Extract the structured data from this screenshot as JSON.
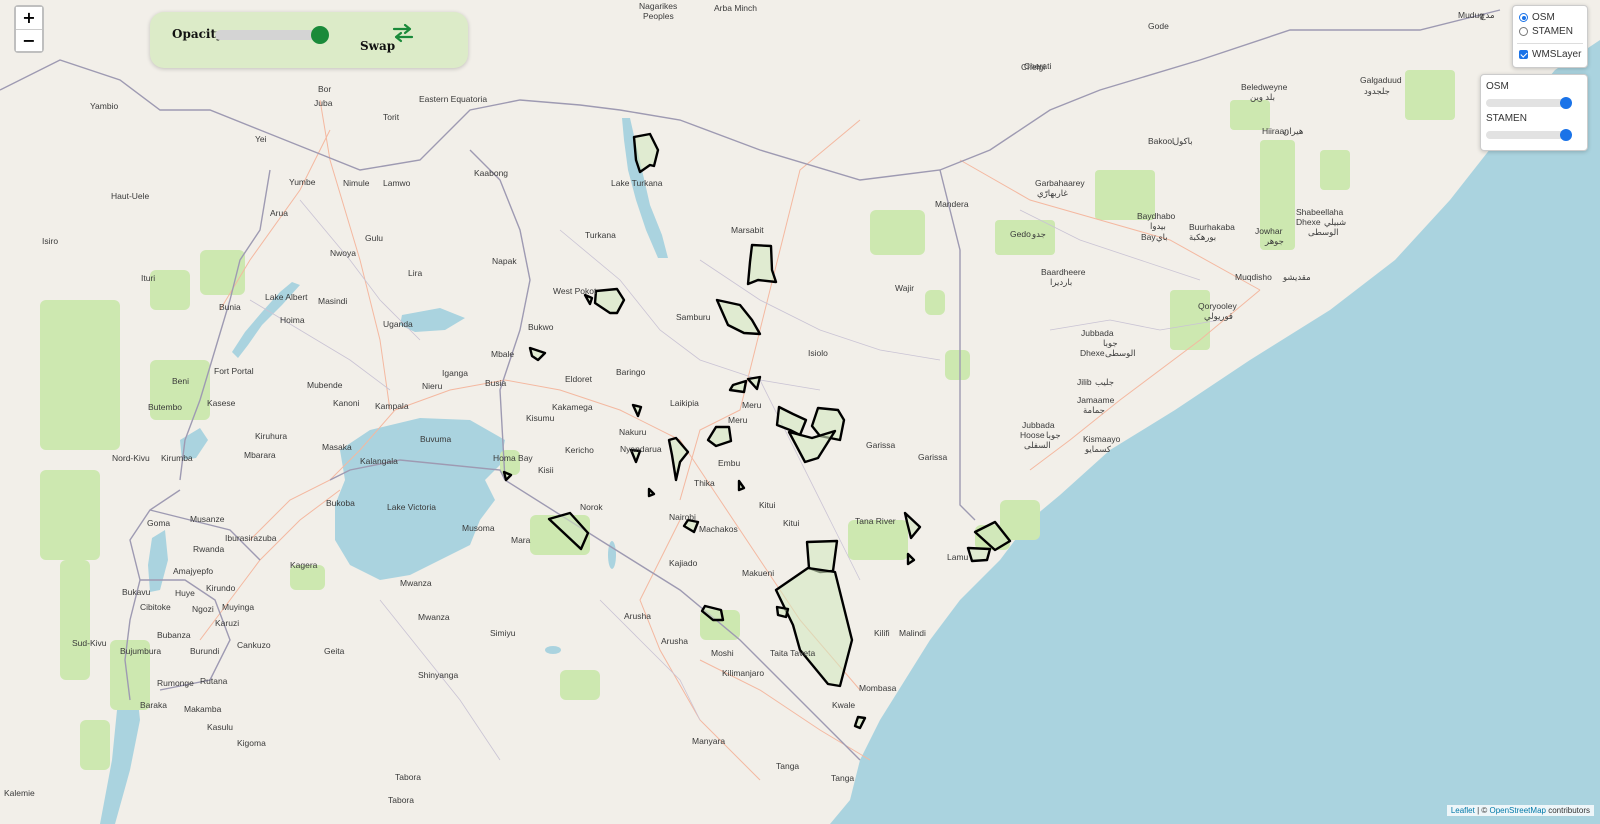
{
  "map": {
    "places": [
      {
        "text": "Nagarikes",
        "cls": "region"
      },
      {
        "text": "Peoples",
        "cls": "region"
      },
      {
        "text": "Arba Minch",
        "cls": "city"
      },
      {
        "text": "Mudug",
        "cls": "region"
      },
      {
        "text": "مدج",
        "cls": "region"
      },
      {
        "text": "Gode",
        "cls": "city"
      },
      {
        "text": "Chelgi",
        "cls": "city"
      },
      {
        "text": "Bor",
        "cls": "city"
      },
      {
        "text": "Juba",
        "cls": "city big"
      },
      {
        "text": "Eastern Equatoria",
        "cls": "region"
      },
      {
        "text": "Yambio",
        "cls": "city"
      },
      {
        "text": "Torit",
        "cls": "city"
      },
      {
        "text": "Yei",
        "cls": "city"
      },
      {
        "text": "Cherati",
        "cls": "city"
      },
      {
        "text": "Beledweyne",
        "cls": "city"
      },
      {
        "text": "بلد وين",
        "cls": "city"
      },
      {
        "text": "Galgaduud",
        "cls": "region"
      },
      {
        "text": "جلجدود",
        "cls": "region"
      },
      {
        "text": "Hiiraan",
        "cls": "region"
      },
      {
        "text": "هيران",
        "cls": "region"
      },
      {
        "text": "Bakool",
        "cls": "region"
      },
      {
        "text": "باكول",
        "cls": "region"
      },
      {
        "text": "Haut-Uele",
        "cls": "region"
      },
      {
        "text": "Yumbe",
        "cls": "city"
      },
      {
        "text": "Nimule",
        "cls": "city"
      },
      {
        "text": "Lamwo",
        "cls": "region"
      },
      {
        "text": "Kaabong",
        "cls": "region"
      },
      {
        "text": "Lake Turkana",
        "cls": "water"
      },
      {
        "text": "Garbahaarey",
        "cls": "city"
      },
      {
        "text": "غاربهارّي",
        "cls": "city"
      },
      {
        "text": "Arua",
        "cls": "city"
      },
      {
        "text": "Gulu",
        "cls": "city"
      },
      {
        "text": "Mandera",
        "cls": "region"
      },
      {
        "text": "Baydhabo",
        "cls": "city"
      },
      {
        "text": "بيدوا",
        "cls": "city"
      },
      {
        "text": "Bay",
        "cls": "region"
      },
      {
        "text": "باي",
        "cls": "region"
      },
      {
        "text": "Buurhakaba",
        "cls": "city"
      },
      {
        "text": "بورهكبة",
        "cls": "city"
      },
      {
        "text": "Jowhar",
        "cls": "city"
      },
      {
        "text": "جوهر",
        "cls": "city"
      },
      {
        "text": "Shabeellaha",
        "cls": "region"
      },
      {
        "text": "Dhexe",
        "cls": "region"
      },
      {
        "text": "شبيلي",
        "cls": "region"
      },
      {
        "text": "الوسطى",
        "cls": "region"
      },
      {
        "text": "Isiro",
        "cls": "city"
      },
      {
        "text": "Turkana",
        "cls": "region"
      },
      {
        "text": "Marsabit",
        "cls": "region"
      },
      {
        "text": "Nwoya",
        "cls": "region"
      },
      {
        "text": "Napak",
        "cls": "region"
      },
      {
        "text": "Gedo",
        "cls": "region"
      },
      {
        "text": "جدو",
        "cls": "region"
      },
      {
        "text": "Baardheere",
        "cls": "city"
      },
      {
        "text": "بارديرا",
        "cls": "city"
      },
      {
        "text": "Muqdisho",
        "cls": "city big"
      },
      {
        "text": "مقديشو",
        "cls": "city big"
      },
      {
        "text": "Ituri",
        "cls": "region"
      },
      {
        "text": "Lira",
        "cls": "city"
      },
      {
        "text": "West Pokot",
        "cls": "region"
      },
      {
        "text": "Wajir",
        "cls": "region"
      },
      {
        "text": "Bunia",
        "cls": "city big"
      },
      {
        "text": "Masindi",
        "cls": "city"
      },
      {
        "text": "Lake Albert",
        "cls": "water"
      },
      {
        "text": "Hoima",
        "cls": "region"
      },
      {
        "text": "Samburu",
        "cls": "region"
      },
      {
        "text": "Qoryooley",
        "cls": "city"
      },
      {
        "text": "قوريولي",
        "cls": "city"
      },
      {
        "text": "Uganda",
        "cls": "country"
      },
      {
        "text": "Bukwo",
        "cls": "city"
      },
      {
        "text": "Jubbada",
        "cls": "region"
      },
      {
        "text": "Dhexe",
        "cls": "region"
      },
      {
        "text": "جوبا",
        "cls": "region"
      },
      {
        "text": "الوسطى",
        "cls": "region"
      },
      {
        "text": "Mbale",
        "cls": "city"
      },
      {
        "text": "Isiolo",
        "cls": "region"
      },
      {
        "text": "Beni",
        "cls": "city"
      },
      {
        "text": "Fort Portal",
        "cls": "city"
      },
      {
        "text": "Iganga",
        "cls": "city"
      },
      {
        "text": "Eldoret",
        "cls": "city"
      },
      {
        "text": "Baringo",
        "cls": "region"
      },
      {
        "text": "Jilib",
        "cls": "city"
      },
      {
        "text": "جليب",
        "cls": "city"
      },
      {
        "text": "Mubende",
        "cls": "region"
      },
      {
        "text": "Nieru",
        "cls": "city"
      },
      {
        "text": "Busia",
        "cls": "city"
      },
      {
        "text": "Jamaame",
        "cls": "city"
      },
      {
        "text": "جمامة",
        "cls": "city"
      },
      {
        "text": "Butembo",
        "cls": "city"
      },
      {
        "text": "Kasese",
        "cls": "city"
      },
      {
        "text": "Kanoni",
        "cls": "city"
      },
      {
        "text": "Kampala",
        "cls": "city big"
      },
      {
        "text": "Kakamega",
        "cls": "city"
      },
      {
        "text": "Laikipia",
        "cls": "region"
      },
      {
        "text": "Meru",
        "cls": "region"
      },
      {
        "text": "Kisumu",
        "cls": "city big"
      },
      {
        "text": "Meru",
        "cls": "city big"
      },
      {
        "text": "Nakuru",
        "cls": "city"
      },
      {
        "text": "Nyandarua",
        "cls": "region"
      },
      {
        "text": "Jubbada",
        "cls": "region"
      },
      {
        "text": "Hoose",
        "cls": "region"
      },
      {
        "text": "جوبا",
        "cls": "region"
      },
      {
        "text": "السفلى",
        "cls": "region"
      },
      {
        "text": "Kiruhura",
        "cls": "region"
      },
      {
        "text": "Buvuma",
        "cls": "water"
      },
      {
        "text": "Nord-Kivu",
        "cls": "region"
      },
      {
        "text": "Kirumba",
        "cls": "city"
      },
      {
        "text": "Mbarara",
        "cls": "city"
      },
      {
        "text": "Masaka",
        "cls": "city"
      },
      {
        "text": "Kalangala",
        "cls": "water"
      },
      {
        "text": "Homa Bay",
        "cls": "water"
      },
      {
        "text": "Kericho",
        "cls": "city"
      },
      {
        "text": "Garissa",
        "cls": "city"
      },
      {
        "text": "Kismaayo",
        "cls": "city"
      },
      {
        "text": "كسمايو",
        "cls": "city"
      },
      {
        "text": "Embu",
        "cls": "city"
      },
      {
        "text": "Garissa",
        "cls": "region"
      },
      {
        "text": "Kisii",
        "cls": "city"
      },
      {
        "text": "Thika",
        "cls": "city"
      },
      {
        "text": "Bukoba",
        "cls": "city"
      },
      {
        "text": "Lake Victoria",
        "cls": "water"
      },
      {
        "text": "Norok",
        "cls": "region"
      },
      {
        "text": "Kitui",
        "cls": "city"
      },
      {
        "text": "Nairobi",
        "cls": "city big"
      },
      {
        "text": "Goma",
        "cls": "city big"
      },
      {
        "text": "Musanze",
        "cls": "city"
      },
      {
        "text": "Musoma",
        "cls": "city"
      },
      {
        "text": "Mara",
        "cls": "region"
      },
      {
        "text": "Machakos",
        "cls": "city"
      },
      {
        "text": "Kitui",
        "cls": "region"
      },
      {
        "text": "Tana River",
        "cls": "region"
      },
      {
        "text": "Iburasirazuba",
        "cls": "region"
      },
      {
        "text": "Rwanda",
        "cls": "country"
      },
      {
        "text": "Amajyepfo",
        "cls": "region"
      },
      {
        "text": "Kagera",
        "cls": "region"
      },
      {
        "text": "Kajiado",
        "cls": "region"
      },
      {
        "text": "Lamu",
        "cls": "region"
      },
      {
        "text": "Makueni",
        "cls": "region"
      },
      {
        "text": "Bukavu",
        "cls": "city"
      },
      {
        "text": "Huye",
        "cls": "city"
      },
      {
        "text": "Mwanza",
        "cls": "city"
      },
      {
        "text": "Kirundo",
        "cls": "city"
      },
      {
        "text": "Cibitoke",
        "cls": "city"
      },
      {
        "text": "Ngozi",
        "cls": "city"
      },
      {
        "text": "Muyinga",
        "cls": "city"
      },
      {
        "text": "Mwanza",
        "cls": "region"
      },
      {
        "text": "Arusha",
        "cls": "region"
      },
      {
        "text": "Karuzi",
        "cls": "city"
      },
      {
        "text": "Simiyu",
        "cls": "region"
      },
      {
        "text": "Kilifi",
        "cls": "region"
      },
      {
        "text": "Bubanza",
        "cls": "city"
      },
      {
        "text": "Arusha",
        "cls": "city big"
      },
      {
        "text": "Malindi",
        "cls": "city"
      },
      {
        "text": "Sud-Kivu",
        "cls": "region"
      },
      {
        "text": "Cankuzo",
        "cls": "city"
      },
      {
        "text": "Bujumbura",
        "cls": "city big"
      },
      {
        "text": "Burundi",
        "cls": "country"
      },
      {
        "text": "Geita",
        "cls": "region"
      },
      {
        "text": "Moshi",
        "cls": "city"
      },
      {
        "text": "Taita Taveta",
        "cls": "region"
      },
      {
        "text": "Kilimanjaro",
        "cls": "region"
      },
      {
        "text": "Rumonge",
        "cls": "city"
      },
      {
        "text": "Rutana",
        "cls": "city"
      },
      {
        "text": "Shinyanga",
        "cls": "region"
      },
      {
        "text": "Mombasa",
        "cls": "city big"
      },
      {
        "text": "Kwale",
        "cls": "region"
      },
      {
        "text": "Baraka",
        "cls": "city"
      },
      {
        "text": "Makamba",
        "cls": "city"
      },
      {
        "text": "Kasulu",
        "cls": "city"
      },
      {
        "text": "Kigoma",
        "cls": "region"
      },
      {
        "text": "Manyara",
        "cls": "region"
      },
      {
        "text": "Tanga",
        "cls": "region"
      },
      {
        "text": "Tanga",
        "cls": "city"
      },
      {
        "text": "Tabora",
        "cls": "city"
      },
      {
        "text": "Tabora",
        "cls": "region"
      },
      {
        "text": "Kalemie",
        "cls": "city"
      }
    ]
  },
  "zoom": {
    "in_label": "+",
    "out_label": "−"
  },
  "opacity_control": {
    "label": "Opacity",
    "value": 0.95,
    "swap_label": "Swap"
  },
  "layers": {
    "base": [
      {
        "label": "OSM",
        "selected": true
      },
      {
        "label": "STAMEN",
        "selected": false
      }
    ],
    "overlay": {
      "label": "WMSLayer",
      "checked": true
    }
  },
  "layer_opacity": [
    {
      "label": "OSM",
      "value": 0.97
    },
    {
      "label": "STAMEN",
      "value": 0.97
    }
  ],
  "attribution": {
    "leaflet": "Leaflet",
    "sep": " | © ",
    "osm": "OpenStreetMap",
    "suffix": " contributors"
  },
  "colors": {
    "land": "#f2efe9",
    "water": "#aad3df",
    "park": "#cde8b0",
    "border": "#9e9ab2",
    "road": "#f4b8a0",
    "accent_green": "#1a8a3a",
    "accent_blue": "#1a73e8",
    "panel_bg": "#dcebc8"
  }
}
